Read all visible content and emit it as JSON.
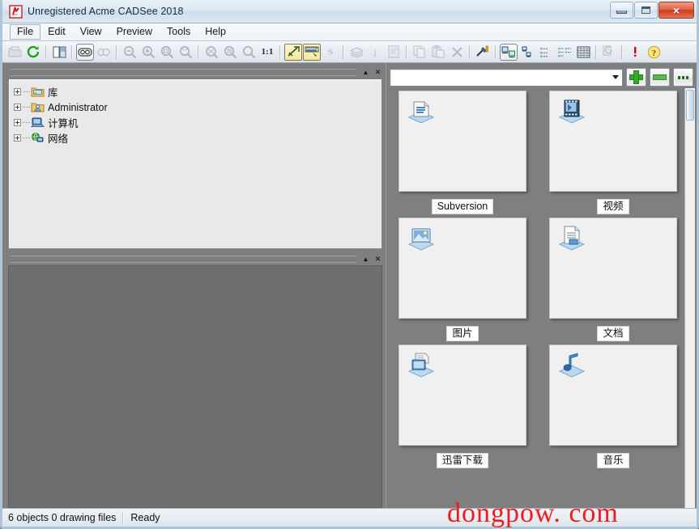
{
  "window": {
    "title": "Unregistered Acme CADSee 2018",
    "app_icon": "cadsee-logo-icon",
    "controls": {
      "minimize": "minimize-button",
      "maximize": "maximize-button",
      "close": "×"
    }
  },
  "menu": {
    "items": [
      "File",
      "Edit",
      "View",
      "Preview",
      "Tools",
      "Help"
    ]
  },
  "toolbar": {
    "groups": [
      {
        "buttons": [
          {
            "name": "open-folder-icon",
            "state": "disabled"
          },
          {
            "name": "refresh-icon",
            "state": "normal"
          }
        ]
      },
      {
        "buttons": [
          {
            "name": "split-view-icon",
            "state": "normal"
          }
        ]
      },
      {
        "buttons": [
          {
            "name": "compare-two-images-icon",
            "state": "framed"
          },
          {
            "name": "compare-pair-icon",
            "state": "disabled"
          }
        ]
      },
      {
        "buttons": [
          {
            "name": "zoom-out-icon",
            "state": "disabled"
          },
          {
            "name": "zoom-in-icon",
            "state": "disabled"
          },
          {
            "name": "zoom-window-icon",
            "state": "disabled"
          },
          {
            "name": "zoom-dynamic-icon",
            "state": "disabled"
          }
        ]
      },
      {
        "buttons": [
          {
            "name": "zoom-extents-icon",
            "state": "disabled"
          },
          {
            "name": "zoom-previous-icon",
            "state": "disabled"
          },
          {
            "name": "zoom-scale-icon",
            "state": "disabled"
          },
          {
            "name": "zoom-actual-size-icon",
            "state": "normal",
            "text": "1:1"
          }
        ]
      },
      {
        "buttons": [
          {
            "name": "measure-tool-icon",
            "state": "active"
          },
          {
            "name": "measure-distance-icon",
            "state": "active"
          },
          {
            "name": "snap-icon",
            "state": "disabled",
            "text": "S"
          }
        ]
      },
      {
        "buttons": [
          {
            "name": "layers-icon",
            "state": "disabled"
          },
          {
            "name": "info-icon",
            "state": "disabled"
          },
          {
            "name": "properties-icon",
            "state": "disabled"
          }
        ]
      },
      {
        "buttons": [
          {
            "name": "copy-icon",
            "state": "disabled"
          },
          {
            "name": "paste-icon",
            "state": "disabled"
          },
          {
            "name": "delete-icon",
            "state": "disabled"
          }
        ]
      },
      {
        "buttons": [
          {
            "name": "settings-tools-icon",
            "state": "normal"
          }
        ]
      },
      {
        "buttons": [
          {
            "name": "view-thumbnails-icon",
            "state": "framed"
          },
          {
            "name": "view-tiles-icon",
            "state": "normal"
          },
          {
            "name": "view-list-icon",
            "state": "normal"
          },
          {
            "name": "view-details-icon",
            "state": "normal"
          },
          {
            "name": "view-report-icon",
            "state": "normal"
          }
        ]
      },
      {
        "buttons": [
          {
            "name": "batch-convert-icon",
            "state": "disabled"
          }
        ]
      },
      {
        "buttons": [
          {
            "name": "alert-icon",
            "state": "normal"
          },
          {
            "name": "help-icon",
            "state": "normal"
          }
        ]
      }
    ]
  },
  "tree_panel": {
    "caption_buttons": {
      "collapse": "▲",
      "close": "✕"
    },
    "items": [
      {
        "label": "库",
        "icon": "library-folder-icon",
        "expandable": true
      },
      {
        "label": "Administrator",
        "icon": "user-folder-icon",
        "expandable": true
      },
      {
        "label": "计算机",
        "icon": "computer-icon",
        "expandable": true
      },
      {
        "label": "网络",
        "icon": "network-icon",
        "expandable": true
      }
    ]
  },
  "preview_panel": {
    "caption_buttons": {
      "collapse": "▲",
      "close": "✕"
    }
  },
  "folder_bar": {
    "path_value": "",
    "path_placeholder": "",
    "dropdown_icon": "chevron-down-icon",
    "add_button": "add-favorite-button",
    "remove_button": "remove-favorite-button",
    "browse_button": "browse-button"
  },
  "thumbnails": [
    {
      "label": "Subversion",
      "icon": "folder-subversion-icon"
    },
    {
      "label": "视频",
      "icon": "folder-video-icon"
    },
    {
      "label": "图片",
      "icon": "folder-pictures-icon"
    },
    {
      "label": "文档",
      "icon": "folder-documents-icon"
    },
    {
      "label": "迅雷下载",
      "icon": "folder-thunder-download-icon"
    },
    {
      "label": "音乐",
      "icon": "folder-music-icon"
    }
  ],
  "status_bar": {
    "objects_text": "6 objects 0 drawing files",
    "ready_text": "Ready"
  },
  "watermark": {
    "text": "dongpow. com",
    "color": "#ee1c1c"
  },
  "colors": {
    "workspace_gray": "#7f7f7f",
    "titlebar_blue": "#cfdeee",
    "close_red": "#cf3a1c",
    "accent_green": "#3aa82f",
    "panel_light": "#e9e9e9"
  }
}
